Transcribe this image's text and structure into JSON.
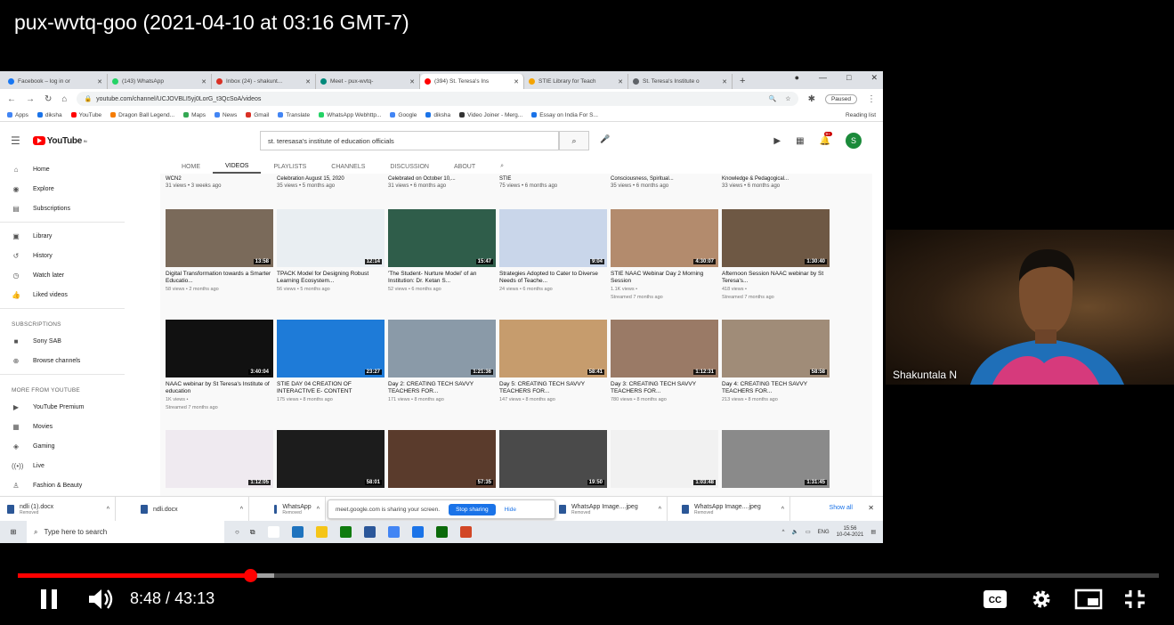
{
  "video_title": "pux-wvtq-goo (2021-04-10 at 03:16 GMT-7)",
  "browser": {
    "tabs": [
      {
        "label": "Facebook – log in or",
        "color": "#1877f2"
      },
      {
        "label": "(143) WhatsApp",
        "color": "#25d366"
      },
      {
        "label": "Inbox (24) - shakunt...",
        "color": "#d93025"
      },
      {
        "label": "Meet - pux-wvtq-",
        "color": "#00897b"
      },
      {
        "label": "(394) St. Teresa's Ins",
        "color": "#ff0000"
      },
      {
        "label": "STIE Library for Teach",
        "color": "#f4a300"
      },
      {
        "label": "St. Teresa's Institute o",
        "color": "#5f6368"
      }
    ],
    "url": "youtube.com/channel/UCJOVBLI5yj0LorG_t3QcSoA/videos",
    "paused_label": "Paused",
    "bookmarks": [
      {
        "label": "Apps",
        "color": "#4285f4"
      },
      {
        "label": "diksha",
        "color": "#1a73e8"
      },
      {
        "label": "YouTube",
        "color": "#ff0000"
      },
      {
        "label": "Dragon Ball Legend...",
        "color": "#f57c00"
      },
      {
        "label": "Maps",
        "color": "#34a853"
      },
      {
        "label": "News",
        "color": "#4285f4"
      },
      {
        "label": "Gmail",
        "color": "#d93025"
      },
      {
        "label": "Translate",
        "color": "#4285f4"
      },
      {
        "label": "WhatsApp Webhttp...",
        "color": "#25d366"
      },
      {
        "label": "Google",
        "color": "#4285f4"
      },
      {
        "label": "diksha",
        "color": "#1a73e8"
      },
      {
        "label": "Video Joiner - Merg...",
        "color": "#333"
      },
      {
        "label": "Essay on India For S...",
        "color": "#1a73e8"
      }
    ],
    "reading_list": "Reading list"
  },
  "youtube": {
    "logo": "YouTube",
    "logo_sup": "IN",
    "search_value": "st. teresasa's institute of education officials",
    "bell_count": "9+",
    "avatar_letter": "S",
    "sidebar": {
      "main": [
        {
          "label": "Home",
          "icon": "⌂"
        },
        {
          "label": "Explore",
          "icon": "◉"
        },
        {
          "label": "Subscriptions",
          "icon": "▤"
        }
      ],
      "library": [
        {
          "label": "Library",
          "icon": "▣"
        },
        {
          "label": "History",
          "icon": "↺"
        },
        {
          "label": "Watch later",
          "icon": "◷"
        },
        {
          "label": "Liked videos",
          "icon": "👍"
        }
      ],
      "subscriptions_heading": "SUBSCRIPTIONS",
      "subscriptions": [
        {
          "label": "Sony SAB",
          "icon": "■"
        },
        {
          "label": "Browse channels",
          "icon": "⊕"
        }
      ],
      "more_heading": "MORE FROM YOUTUBE",
      "more": [
        {
          "label": "YouTube Premium",
          "icon": "▶"
        },
        {
          "label": "Movies",
          "icon": "▦"
        },
        {
          "label": "Gaming",
          "icon": "◈"
        },
        {
          "label": "Live",
          "icon": "((•))"
        },
        {
          "label": "Fashion & Beauty",
          "icon": "♙"
        }
      ]
    },
    "channel_tabs": [
      "HOME",
      "VIDEOS",
      "PLAYLISTS",
      "CHANNELS",
      "DISCUSSION",
      "ABOUT"
    ],
    "top_row": [
      {
        "title": "WCN2",
        "meta": "31 views • 3 weeks ago"
      },
      {
        "title": "Celebration August 15, 2020",
        "meta": "35 views • 5 months ago"
      },
      {
        "title": "Celebrated on October 10,...",
        "meta": "31 views • 6 months ago"
      },
      {
        "title": "STIE",
        "meta": "75 views • 6 months ago"
      },
      {
        "title": "Consciousness, Spiritual...",
        "meta": "35 views • 6 months ago"
      },
      {
        "title": "Knowledge & Pedagogical...",
        "meta": "33 views • 6 months ago"
      }
    ],
    "videos": [
      {
        "title": "Digital Transformation towards a Smarter Educatio...",
        "meta1": "58 views • 2 months ago",
        "meta2": "",
        "duration": "13:58",
        "bg": "#7a6a5a"
      },
      {
        "title": "TPACK Model for Designing Robust Learning Ecosystem...",
        "meta1": "56 views • 5 months ago",
        "meta2": "",
        "duration": "12:14",
        "bg": "#e9eef2"
      },
      {
        "title": "'The Student- Nurture Model' of an Institution: Dr. Ketan S...",
        "meta1": "52 views • 6 months ago",
        "meta2": "",
        "duration": "15:47",
        "bg": "#2f5d4a"
      },
      {
        "title": "Strategies Adopted to Cater to Diverse Needs of Teache...",
        "meta1": "24 views • 6 months ago",
        "meta2": "",
        "duration": "9:04",
        "bg": "#c9d6ea"
      },
      {
        "title": "STIE NAAC Webinar Day 2 Morning Session",
        "meta1": "1.1K views •",
        "meta2": "Streamed 7 months ago",
        "duration": "4:30:07",
        "bg": "#b38b6d"
      },
      {
        "title": "Afternoon Session NAAC webinar by St Teresa's...",
        "meta1": "418 views •",
        "meta2": "Streamed 7 months ago",
        "duration": "1:30:40",
        "bg": "#6e5844"
      },
      {
        "title": "NAAC webinar by St Teresa's Institute of education",
        "meta1": "1K views •",
        "meta2": "Streamed 7 months ago",
        "duration": "3:40:04",
        "bg": "#111111"
      },
      {
        "title": "STIE DAY 04 CREATION OF INTERACTIVE E- CONTENT",
        "meta1": "175 views • 8 months ago",
        "meta2": "",
        "duration": "23:27",
        "bg": "#1e7bd8"
      },
      {
        "title": "Day 2: CREATING TECH SAVVY TEACHERS FOR...",
        "meta1": "171 views • 8 months ago",
        "meta2": "",
        "duration": "1:21:36",
        "bg": "#8a9aa8"
      },
      {
        "title": "Day 5: CREATING TECH SAVVY TEACHERS FOR...",
        "meta1": "147 views • 8 months ago",
        "meta2": "",
        "duration": "58:41",
        "bg": "#c69c6d"
      },
      {
        "title": "Day 3: CREATING TECH SAVVY TEACHERS FOR...",
        "meta1": "780 views • 8 months ago",
        "meta2": "",
        "duration": "1:12:31",
        "bg": "#9a7a66"
      },
      {
        "title": "Day 4: CREATING TECH SAVVY TEACHERS FOR...",
        "meta1": "213 views • 8 months ago",
        "meta2": "",
        "duration": "58:58",
        "bg": "#a08c78"
      },
      {
        "title": "",
        "meta1": "",
        "meta2": "",
        "duration": "1:12:05",
        "bg": "#efeaf0"
      },
      {
        "title": "",
        "meta1": "",
        "meta2": "",
        "duration": "58:01",
        "bg": "#1c1c1c"
      },
      {
        "title": "",
        "meta1": "",
        "meta2": "",
        "duration": "57:35",
        "bg": "#5a3b2c"
      },
      {
        "title": "",
        "meta1": "",
        "meta2": "",
        "duration": "19:50",
        "bg": "#4a4a4a"
      },
      {
        "title": "",
        "meta1": "",
        "meta2": "",
        "duration": "1:03:48",
        "bg": "#f1f1f1"
      },
      {
        "title": "",
        "meta1": "",
        "meta2": "",
        "duration": "1:31:45",
        "bg": "#8a8a8a"
      }
    ]
  },
  "downloads": {
    "items": [
      {
        "name": "ndli (1).docx",
        "status": "Removed"
      },
      {
        "name": "ndli.docx",
        "status": ""
      },
      {
        "name": "WhatsApp",
        "status": "Removed"
      },
      {
        "name": "WhatsApp Image....jpeg",
        "status": "Removed"
      },
      {
        "name": "WhatsApp Image....jpeg",
        "status": "Removed"
      }
    ],
    "share_text": "meet.google.com is sharing your screen.",
    "stop_label": "Stop sharing",
    "hide_label": "Hide",
    "show_all": "Show all"
  },
  "taskbar": {
    "search_placeholder": "Type here to search",
    "lang": "ENG",
    "time": "15:56",
    "date": "10-04-2021",
    "app_colors": [
      "#ffffff",
      "#1e73be",
      "#f5c518",
      "#0f7b0f",
      "#2b579a",
      "#4285f4",
      "#1a73e8",
      "#0b6a0b",
      "#d24726"
    ]
  },
  "participant": {
    "name": "Shakuntala N"
  },
  "player": {
    "current_time": "8:48",
    "separator": " / ",
    "duration": "43:13",
    "played_fraction": 0.2036,
    "buffered_fraction": 0.225
  }
}
